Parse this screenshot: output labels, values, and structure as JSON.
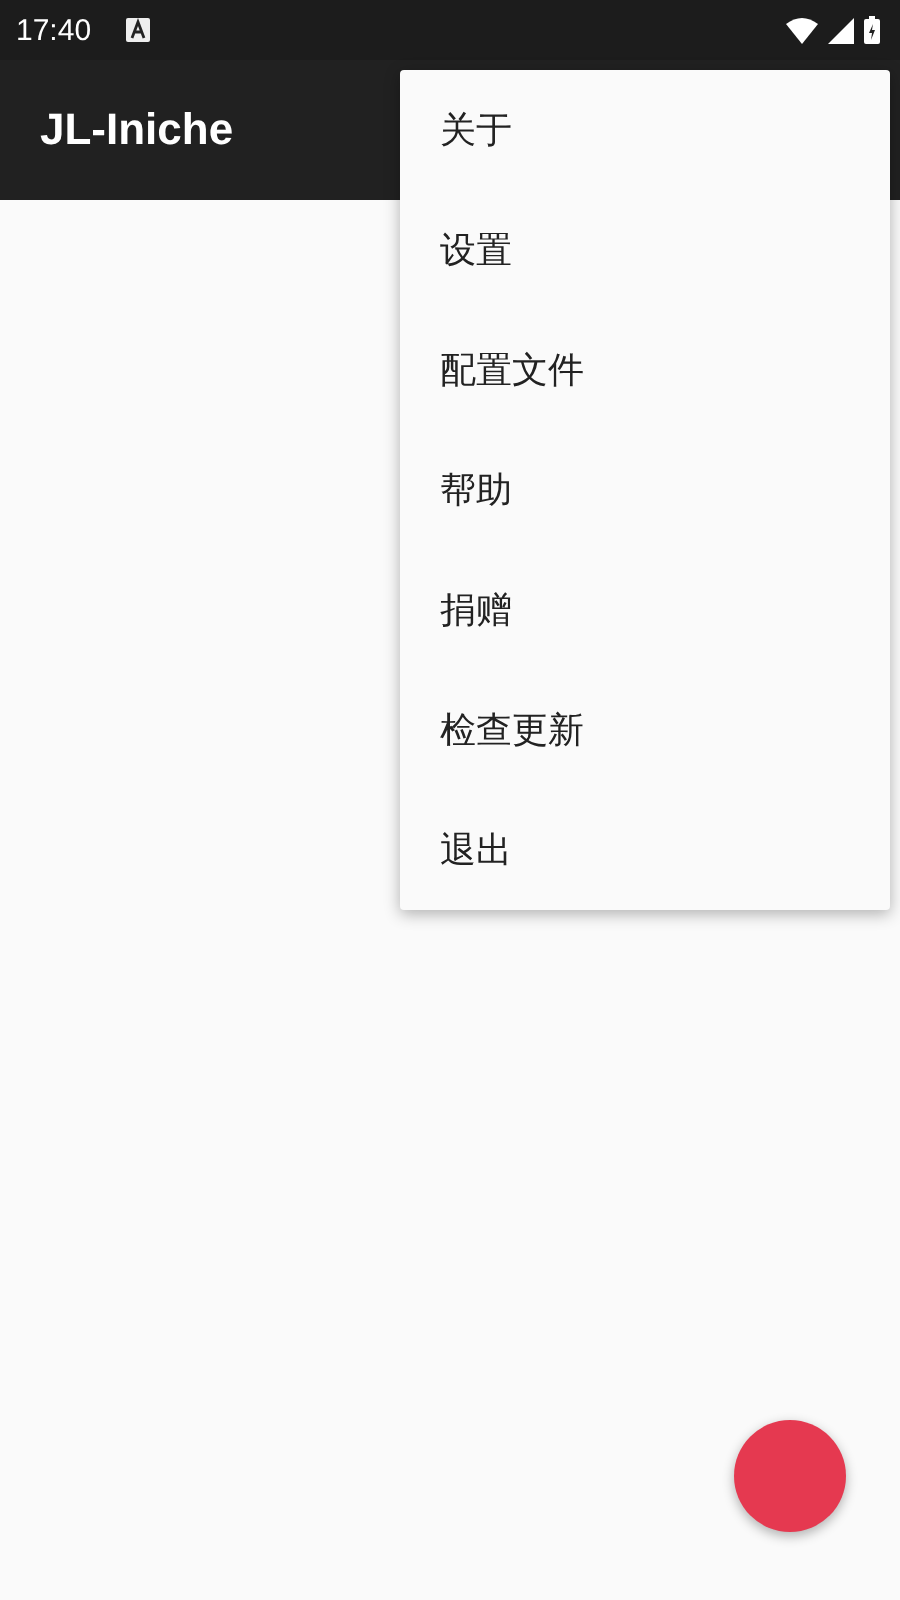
{
  "status_bar": {
    "time": "17:40"
  },
  "app_bar": {
    "title": "JL-Iniche"
  },
  "menu": {
    "items": [
      {
        "label": "关于"
      },
      {
        "label": "设置"
      },
      {
        "label": "配置文件"
      },
      {
        "label": "帮助"
      },
      {
        "label": "捐赠"
      },
      {
        "label": "检查更新"
      },
      {
        "label": "退出"
      }
    ]
  }
}
